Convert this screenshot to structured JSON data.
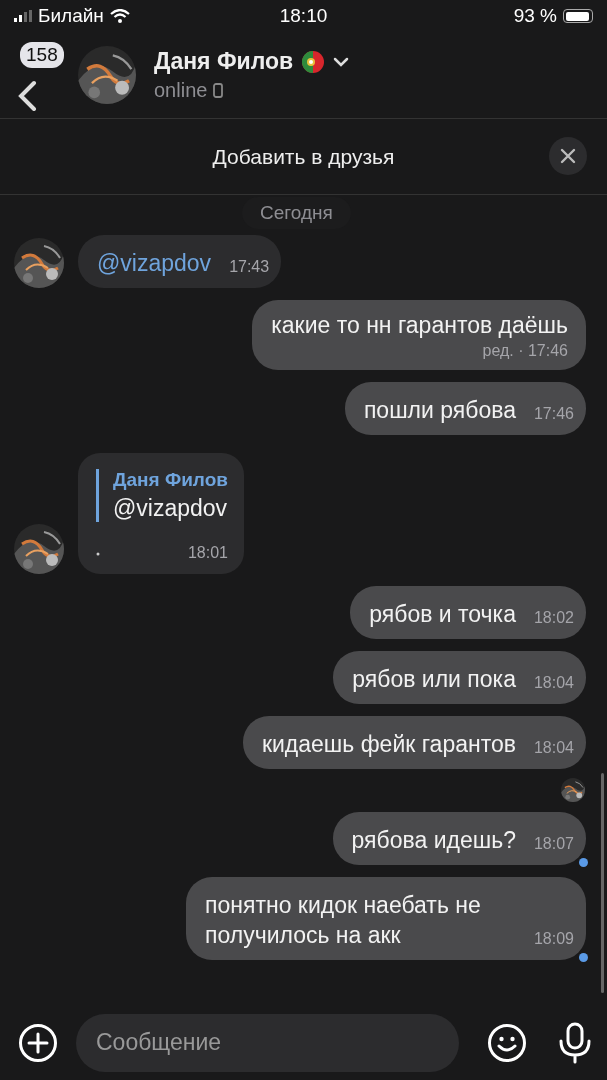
{
  "status_bar": {
    "carrier": "Билайн",
    "time": "18:10",
    "battery": "93 %"
  },
  "header": {
    "back_badge": "158",
    "name": "Даня Филов",
    "status": "online"
  },
  "banner": {
    "text": "Добавить в друзья"
  },
  "date_pill": "Сегодня",
  "messages": [
    {
      "kind": "in",
      "avatar": true,
      "text": "@vizapdov",
      "link": true,
      "time": "17:43"
    },
    {
      "kind": "out",
      "text": "какие то нн гарантов даёшь",
      "edited": "ред. · 17:46",
      "unread": false
    },
    {
      "kind": "out",
      "text": "пошли рябова",
      "time": "17:46",
      "unread": false
    },
    {
      "kind": "in",
      "avatar": true,
      "reply": {
        "author": "Даня Филов",
        "text": "@vizapdov"
      },
      "time": "18:01"
    },
    {
      "kind": "out",
      "text": "рябов и точка",
      "time": "18:02",
      "unread": false
    },
    {
      "kind": "out",
      "text": "рябов или пока",
      "time": "18:04",
      "unread": false
    },
    {
      "kind": "out",
      "text": "кидаешь фейк гарантов",
      "time": "18:04",
      "unread": false,
      "read_avatar": true
    },
    {
      "kind": "out",
      "text": "рябова идешь?",
      "time": "18:07",
      "unread": true
    },
    {
      "kind": "out",
      "text": "понятно кидок наебать не получилось на акк",
      "time": "18:09",
      "unread": true
    }
  ],
  "composer": {
    "placeholder": "Сообщение"
  }
}
